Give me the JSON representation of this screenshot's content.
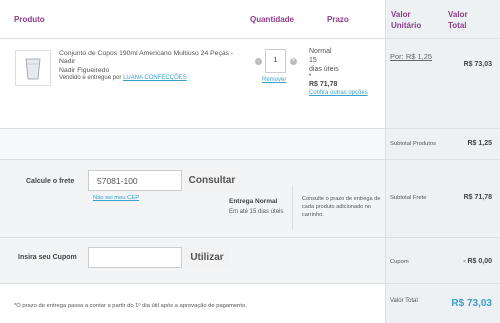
{
  "header": {
    "product": "Produto",
    "quantity": "Quantidade",
    "deadline": "Prazo",
    "unit_value": "Valor Unitário",
    "total_value": "Valor Total"
  },
  "item": {
    "name": "Conjunto de Copos 190ml Americano Multiuso 24 Peças - Nadir",
    "brand": "Nadir Figueiredo",
    "seller_prefix": "Vendido e entregue por",
    "seller": "LUANA CONFECÇÕES",
    "quantity": "1",
    "minus": "-",
    "plus": "+",
    "remove": "Remover",
    "shipping_type": "Normal",
    "shipping_days": "15",
    "shipping_days_label": "dias úteis",
    "shipping_price": "R$ 71,78",
    "other_options": "Confira outras opções",
    "unit_price": "Por: R$ 1,25",
    "total_price": "R$ 73,03"
  },
  "summary": {
    "subtotal_products_label": "Subtotal Produtos",
    "subtotal_products_value": "R$ 1,25",
    "subtotal_freight_label": "Subtotal Frete",
    "subtotal_freight_value": "R$ 71,78",
    "coupon_label": "Cupom",
    "coupon_value": "- R$ 0,00",
    "total_label": "Valor Total",
    "total_value": "R$ 73,03"
  },
  "freight": {
    "label": "Calcule o frete",
    "cep_value": "57081-100",
    "button": "Consultar",
    "dont_know_cep": "Não sei meu CEP",
    "delivery_type": "Entrega Normal",
    "delivery_time": "Em até 15 dias úteis",
    "note": "Consulte o prazo de entrega de cada produto adicionado no carrinho."
  },
  "coupon": {
    "label": "Insira seu Cupom",
    "value": "",
    "button": "Utilizar"
  },
  "footnote": "*O prazo de entrega passa a contar a partir do 1º dia útil após a aprovação de pagamento.",
  "colors": {
    "accent": "#8e3c88",
    "link": "#3aa0c8",
    "total": "#3aa0c8",
    "panel": "#eef1f4"
  }
}
